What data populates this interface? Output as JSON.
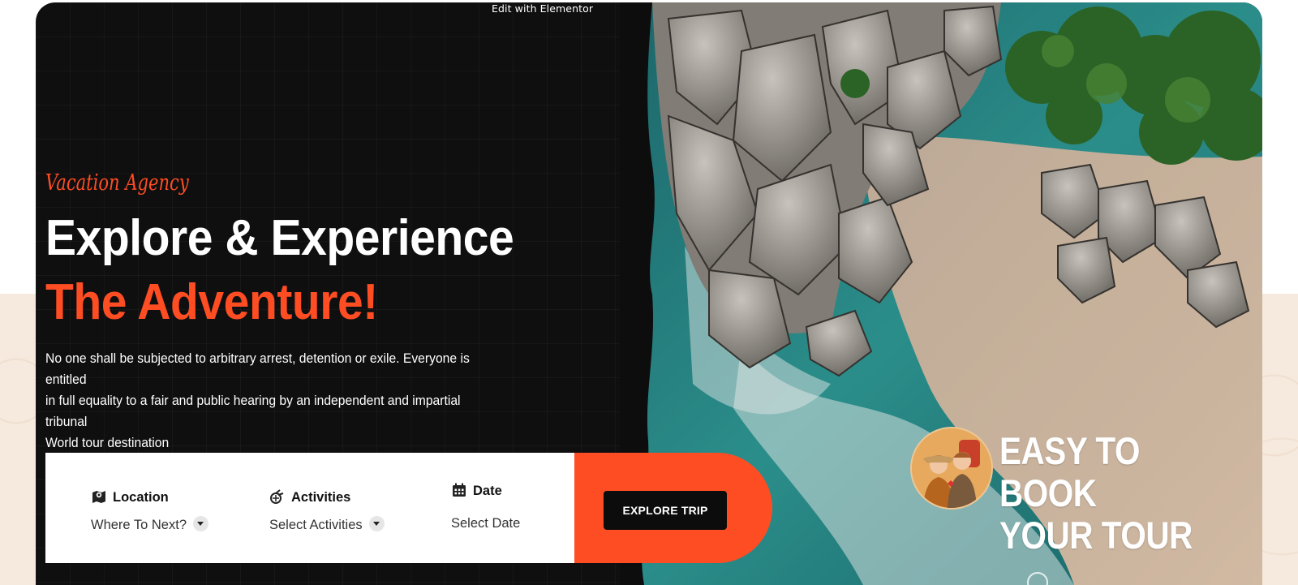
{
  "editor": {
    "edit_link": "Edit with Elementor"
  },
  "hero": {
    "tagline": "Vacation Agency",
    "title_line1": "Explore & Experience",
    "title_line2": "The Adventure!",
    "description_line1": "No one shall be subjected to arbitrary arrest, detention or exile. Everyone is entitled",
    "description_line2": "in full equality to a fair and public hearing by an independent and impartial tribunal",
    "description_line3": "World tour destination",
    "badge_line1": "EASY TO BOOK",
    "badge_line2": "YOUR TOUR"
  },
  "booking": {
    "location_label": "Location",
    "location_value": "Where To Next?",
    "activities_label": "Activities",
    "activities_value": "Select Activities",
    "date_label": "Date",
    "date_value": "Select Date",
    "button_label": "EXPLORE TRIP"
  },
  "icons": {
    "location": "map-marker-icon",
    "activities": "activities-icon",
    "date": "calendar-icon",
    "dropdown": "chevron-down-icon"
  },
  "colors": {
    "accent": "#ff4d23",
    "hero_bg": "#0f0f10",
    "button_bg": "#0c0c0c",
    "band_bg": "#f6e9dd"
  }
}
